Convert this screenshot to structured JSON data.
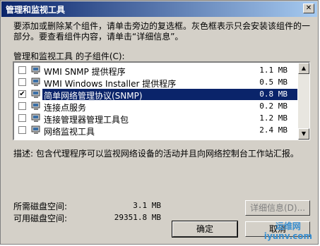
{
  "window": {
    "title": "管理和监视工具",
    "close_glyph": "✕"
  },
  "description": "要添加或删除某个组件，请单击旁边的复选框。灰色框表示只会安装该组件的一部分。要查看组件内容，请单击“详细信息”。",
  "list_label": "管理和监视工具 的子组件(C):",
  "components": [
    {
      "name": "WMI SNMP 提供程序",
      "size": "1.1 MB",
      "checked": false,
      "selected": false
    },
    {
      "name": "WMI Windows Installer 提供程序",
      "size": "0.5 MB",
      "checked": false,
      "selected": false
    },
    {
      "name": "简单网络管理协议(SNMP)",
      "size": "0.8 MB",
      "checked": true,
      "selected": true
    },
    {
      "name": "连接点服务",
      "size": "0.2 MB",
      "checked": false,
      "selected": false
    },
    {
      "name": "连接管理器管理工具包",
      "size": "1.2 MB",
      "checked": false,
      "selected": false
    },
    {
      "name": "网络监视工具",
      "size": "2.4 MB",
      "checked": false,
      "selected": false
    }
  ],
  "summary": "描述:  包含代理程序可以监视网络设备的活动并且向网络控制台工作站汇报。",
  "disk": {
    "required_label": "所需磁盘空间:",
    "required_value": "3.1 MB",
    "available_label": "可用磁盘空间:",
    "available_value": "29351.8 MB"
  },
  "buttons": {
    "details": "详细信息(D)...",
    "ok": "确定",
    "cancel": "取消"
  },
  "watermark": {
    "line1": "运维网",
    "line2": "iyunv.com"
  },
  "colors": {
    "titlebar": "#0a246a",
    "selection": "#0a246a",
    "face": "#d4d0c8"
  }
}
